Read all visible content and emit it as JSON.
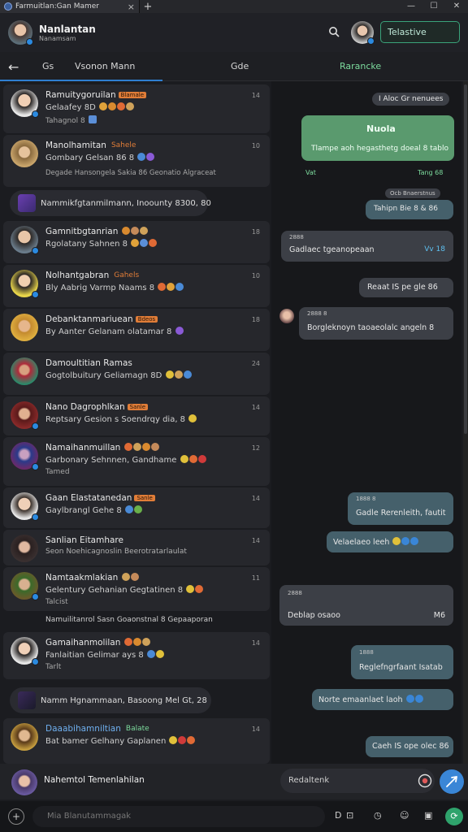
{
  "window": {
    "tab_title": "Farmuitlan:Gan Mamer",
    "close": "×",
    "new_tab": "+",
    "controls": [
      "—",
      "☐",
      "✕"
    ]
  },
  "header": {
    "name": "Nanlantan",
    "subtitle": "Nanamsam",
    "status_button": "Telastive"
  },
  "tabs": {
    "back": "←",
    "items": [
      "Gs",
      "Vsonon   Mann",
      "Gde",
      "Rarancke"
    ],
    "active_color": "#2f7fd1",
    "green_label_color": "#7ddc9e"
  },
  "list": {
    "rows": [
      {
        "name": "Ramuitygoruilan",
        "tag": "Blamale",
        "line2": "Gelaafey 8D",
        "line3": "Tahagnol 8",
        "time": "14"
      },
      {
        "name": "Manolhamitan",
        "tag": "Sahele",
        "line2": "Gombary Gelsan 86 8",
        "line3": "Degade Hansongela Sakia 86   Geonatio Algraceat",
        "time": "10"
      },
      {
        "name": "Nammikfgtanmilmann, Inoounty 8300, 80",
        "tag": "",
        "line2": "",
        "line3": "",
        "time": ""
      },
      {
        "name": "Gamnitbgtanrian",
        "tag": "",
        "line2": "Rgolatany Sahnen 8",
        "line3": "",
        "time": "18"
      },
      {
        "name": "Nolhantgabran",
        "tag": "Gahels",
        "line2": "Bly Aabrig Varmp Naams 8",
        "line3": "",
        "time": "10"
      },
      {
        "name": "Debanktanmariuean",
        "tag": "Bdeos",
        "line2": "By Aanter Gelanam olatamar 8",
        "line3": "",
        "time": "18"
      },
      {
        "name": "Damoultitian Ramas",
        "tag": "",
        "line2": "Gogtolbuitury Geliamagn 8D",
        "line3": "",
        "time": "24"
      },
      {
        "name": "Nano Dagrophlkan",
        "tag": "Sanle",
        "line2": "Reptsary Gesion s Soendrqy dia, 8",
        "line3": "",
        "time": "14"
      },
      {
        "name": "Namaihanmuillan",
        "tag": "",
        "line2": "Garbonary Sehnnen, Gandhame",
        "line3": "Tamed",
        "time": "12"
      },
      {
        "name": "Gaan Elastatanedan",
        "tag": "Sanle",
        "line2": "Gaylbrangl Gehe 8",
        "line3": "",
        "time": "14"
      },
      {
        "name": "Sanlian Eitamhare",
        "tag": "",
        "line2": "Seon Noehicagnoslin Beerotratarlaulat",
        "line3": "",
        "time": "14"
      },
      {
        "name": "Namtaakmlakian",
        "tag": "",
        "line2": "Gelentury Gehanian Gegtatinen 8",
        "line3": "Talcist",
        "time": "11"
      },
      {
        "name": "Namuilitanrol Sasn  Goaonstnal 8 Gepaaporan",
        "tag": "",
        "line2": "",
        "line3": "",
        "time": ""
      },
      {
        "name": "Gamaihanmolilan",
        "tag": "",
        "line2": "Fanlaitian Gelimar ays 8",
        "line3": "Tarlt",
        "time": "14"
      },
      {
        "name": "Namm Hgnammaan, Basoong Mel Gt, 28",
        "tag": "",
        "line2": "",
        "line3": "",
        "time": ""
      },
      {
        "name": "Daaabihamniltian",
        "tag": "Balate",
        "line2": "Bat bamer Gelhany Gaplanen",
        "line3": "",
        "time": "14"
      }
    ]
  },
  "chat": {
    "messages": [
      {
        "text": "I Aloc Gr nenuees",
        "kind": "in"
      },
      {
        "title": "Nuola",
        "text": "Tlampe aoh hegasthetg doeal 8 tablo",
        "kind": "green",
        "meta_left": "Vat",
        "meta_right": "Tang 68"
      },
      {
        "text": "Ocb Bnaerstnus",
        "kind": "in"
      },
      {
        "text": "Tahipn Bie 8 & 86",
        "kind": "out"
      },
      {
        "small": "2888",
        "text": "Gadlaec tgeanopeaan",
        "meta": "Vv   18",
        "kind": "in"
      },
      {
        "text": "Reaat IS pe gle 86",
        "kind": "in"
      },
      {
        "small": "2888 8",
        "text": "Borgleknoyn taoaeolalc angeln 8",
        "kind": "in"
      },
      {
        "small": "1888 8",
        "text": "Gadle Rerenleith, fautit",
        "kind": "out"
      },
      {
        "text": "Velaelaeo leeh",
        "kind": "out"
      },
      {
        "small": "2888",
        "text": "Deblap osaoo",
        "meta": "M6",
        "kind": "in"
      },
      {
        "small": "1888",
        "text": "Reglefngrfaant Isatab",
        "kind": "out"
      },
      {
        "text": "Norte emaanlaet laoh",
        "kind": "out"
      },
      {
        "text": "Caeh IS ope olec 86",
        "kind": "out"
      }
    ]
  },
  "composer": {
    "name": "Nahemtol Temenlahilan",
    "placeholder": "Redaltenk"
  },
  "bottombar": {
    "plus": "+",
    "placeholder": "Mia Blanutammagak",
    "icons": [
      "D",
      "⊡",
      "◷",
      "☺",
      "▣"
    ]
  }
}
